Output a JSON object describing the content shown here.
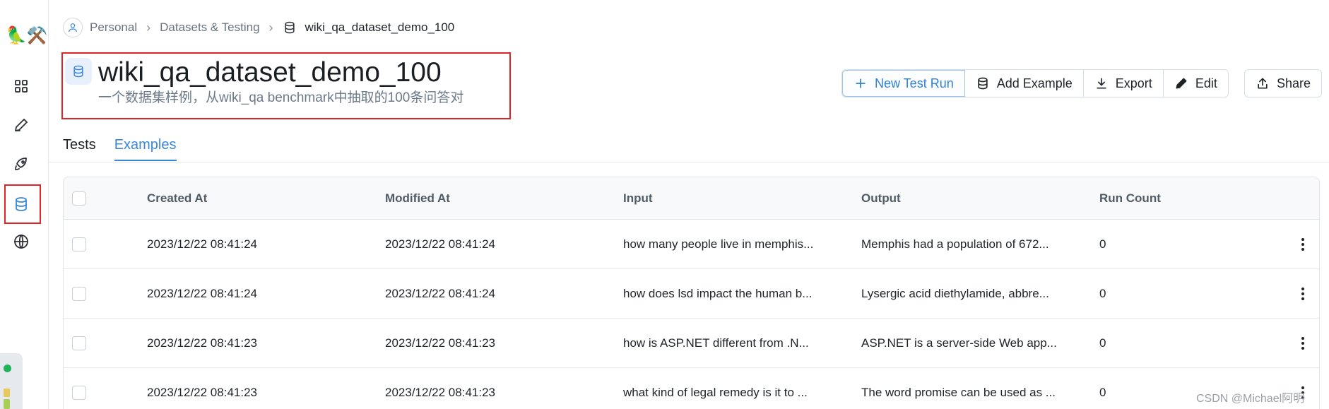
{
  "sidebar": {
    "logo": "🦜⚒️",
    "items": [
      {
        "name": "grid-icon"
      },
      {
        "name": "pen-icon"
      },
      {
        "name": "rocket-icon"
      },
      {
        "name": "database-icon",
        "active": true
      },
      {
        "name": "globe-icon"
      }
    ]
  },
  "breadcrumb": {
    "items": [
      "Personal",
      "Datasets & Testing",
      "wiki_qa_dataset_demo_100"
    ]
  },
  "header": {
    "title": "wiki_qa_dataset_demo_100",
    "description": "一个数据集样例，从wiki_qa benchmark中抽取的100条问答对"
  },
  "toolbar": {
    "new_test_run": "New Test Run",
    "add_example": "Add Example",
    "export": "Export",
    "edit": "Edit",
    "share": "Share"
  },
  "tabs": [
    {
      "label": "Tests",
      "active": false
    },
    {
      "label": "Examples",
      "active": true
    }
  ],
  "table": {
    "columns": [
      "Created At",
      "Modified At",
      "Input",
      "Output",
      "Run Count"
    ],
    "rows": [
      {
        "created": "2023/12/22 08:41:24",
        "modified": "2023/12/22 08:41:24",
        "input": "how many people live in memphis...",
        "output": "Memphis had a population of 672...",
        "run_count": "0"
      },
      {
        "created": "2023/12/22 08:41:24",
        "modified": "2023/12/22 08:41:24",
        "input": "how does lsd impact the human b...",
        "output": "Lysergic acid diethylamide, abbre...",
        "run_count": "0"
      },
      {
        "created": "2023/12/22 08:41:23",
        "modified": "2023/12/22 08:41:23",
        "input": "how is ASP.NET different from .N...",
        "output": "ASP.NET is a server-side Web app...",
        "run_count": "0"
      },
      {
        "created": "2023/12/22 08:41:23",
        "modified": "2023/12/22 08:41:23",
        "input": "what kind of legal remedy is it to ...",
        "output": "The word promise can be used as ...",
        "run_count": "0"
      }
    ]
  },
  "watermark": "CSDN @Michael阿明",
  "colors": {
    "accent": "#3b87d9",
    "highlight_border": "#e02424"
  }
}
